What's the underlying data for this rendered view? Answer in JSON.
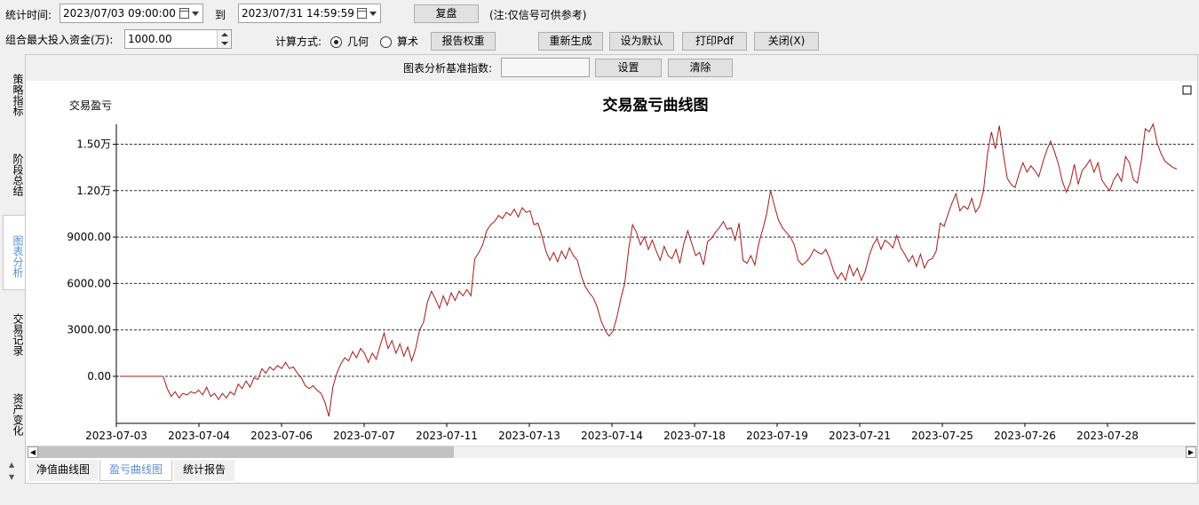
{
  "filters": {
    "time_label": "统计时间:",
    "start_datetime": "2023/07/03 09:00:00",
    "to_label": "到",
    "end_datetime": "2023/07/31 14:59:59",
    "replay_button": "复盘",
    "note": "(注:仅信号可供参考)",
    "max_capital_label": "组合最大投入资金(万):",
    "max_capital_value": "1000.00",
    "calc_method_label": "计算方式:",
    "calc_options": [
      "几何",
      "算术"
    ],
    "calc_selected": "几何",
    "report_weight_button": "报告权重",
    "regenerate_button": "重新生成",
    "set_default_button": "设为默认",
    "print_pdf_button": "打印Pdf",
    "close_button": "关闭(X)",
    "benchmark_label": "图表分析基准指数:",
    "benchmark_value": "",
    "set_button": "设置",
    "clear_button": "清除"
  },
  "side_tabs": [
    {
      "label": "策略指标",
      "active": false
    },
    {
      "label": "阶段总结",
      "active": false
    },
    {
      "label": "图表分析",
      "active": true
    },
    {
      "label": "交易记录",
      "active": false
    },
    {
      "label": "资产变化",
      "active": false
    }
  ],
  "bottom_tabs": [
    {
      "label": "净值曲线图",
      "active": false
    },
    {
      "label": "盈亏曲线图",
      "active": true
    },
    {
      "label": "统计报告",
      "active": false
    }
  ],
  "colors": {
    "line": "#a81818",
    "active_tab_text": "#5b8fd0"
  },
  "chart_data": {
    "type": "line",
    "title": "交易盈亏曲线图",
    "ylabel": "交易盈亏",
    "ylim": [
      -2000,
      17000
    ],
    "y_ticks": [
      0,
      3000,
      6000,
      9000,
      12000,
      15000
    ],
    "y_tick_labels": [
      "0.00",
      "3000.00",
      "6000.00",
      "9000.00",
      "1.20万",
      "1.50万"
    ],
    "grid": "horizontal dashed",
    "x_tick_labels": [
      "2023-07-03",
      "2023-07-04",
      "2023-07-06",
      "2023-07-07",
      "2023-07-11",
      "2023-07-13",
      "2023-07-14",
      "2023-07-18",
      "2023-07-19",
      "2023-07-21",
      "2023-07-25",
      "2023-07-26",
      "2023-07-28"
    ],
    "series": [
      {
        "values": [
          0,
          0,
          0,
          0,
          0,
          0,
          0,
          0,
          0,
          0,
          0,
          0,
          -800,
          -1300,
          -1000,
          -1400,
          -1100,
          -1200,
          -1000,
          -1100,
          -900,
          -1200,
          -700,
          -1300,
          -1100,
          -1500,
          -1100,
          -1400,
          -1000,
          -1200,
          -500,
          -800,
          -300,
          -700,
          -100,
          -200,
          500,
          200,
          600,
          400,
          700,
          500,
          900,
          500,
          600,
          200,
          -100,
          -600,
          -800,
          -600,
          -900,
          -1100,
          -1700,
          -2600,
          -700,
          200,
          800,
          1200,
          1000,
          1600,
          1200,
          1800,
          1500,
          900,
          1500,
          1100,
          2000,
          2800,
          1800,
          2300,
          1500,
          2100,
          1300,
          1900,
          1000,
          1800,
          3000,
          3500,
          4800,
          5500,
          5000,
          4400,
          5200,
          4600,
          5400,
          4900,
          5500,
          5200,
          5600,
          5200,
          7600,
          8000,
          8500,
          9400,
          9800,
          10000,
          10400,
          10200,
          10600,
          10400,
          10800,
          10300,
          10900,
          10600,
          10700,
          9800,
          9900,
          9100,
          8100,
          7500,
          8000,
          7400,
          8100,
          7600,
          8300,
          7800,
          7500,
          6500,
          5800,
          5400,
          5100,
          4500,
          3600,
          3000,
          2600,
          2900,
          3800,
          5000,
          6000,
          8200,
          9800,
          9300,
          8500,
          9000,
          8200,
          8800,
          8100,
          7500,
          8400,
          7800,
          7600,
          8200,
          7300,
          8600,
          9400,
          8600,
          7800,
          8000,
          7200,
          8700,
          8900,
          9300,
          9600,
          10000,
          9500,
          9600,
          8800,
          9900,
          7500,
          7300,
          7800,
          7200,
          8600,
          9500,
          10500,
          12000,
          11000,
          10100,
          9600,
          9300,
          9000,
          8500,
          7500,
          7200,
          7400,
          7700,
          8200,
          8000,
          7900,
          8200,
          7600,
          6800,
          6300,
          6700,
          6200,
          7200,
          6500,
          7000,
          6200,
          6800,
          7800,
          8500,
          8900,
          8200,
          8800,
          8600,
          8300,
          9100,
          8300,
          7900,
          7400,
          7800,
          7100,
          7900,
          7000,
          7500,
          7600,
          8100,
          9900,
          9700,
          10500,
          11200,
          11800,
          10700,
          11000,
          10800,
          11500,
          10600,
          11000,
          12000,
          14400,
          15800,
          14700,
          16200,
          14400,
          12800,
          12400,
          12200,
          13100,
          13800,
          13200,
          13600,
          13300,
          12900,
          13800,
          14600,
          15200,
          14500,
          13700,
          12600,
          11900,
          12500,
          13700,
          12400,
          13300,
          13600,
          14000,
          13200,
          13800,
          12700,
          12300,
          12000,
          12700,
          13100,
          12600,
          14200,
          13800,
          12700,
          12500,
          13900,
          16000,
          15800,
          16300,
          15100,
          14400,
          13900,
          13700,
          13500,
          13400
        ]
      }
    ]
  }
}
